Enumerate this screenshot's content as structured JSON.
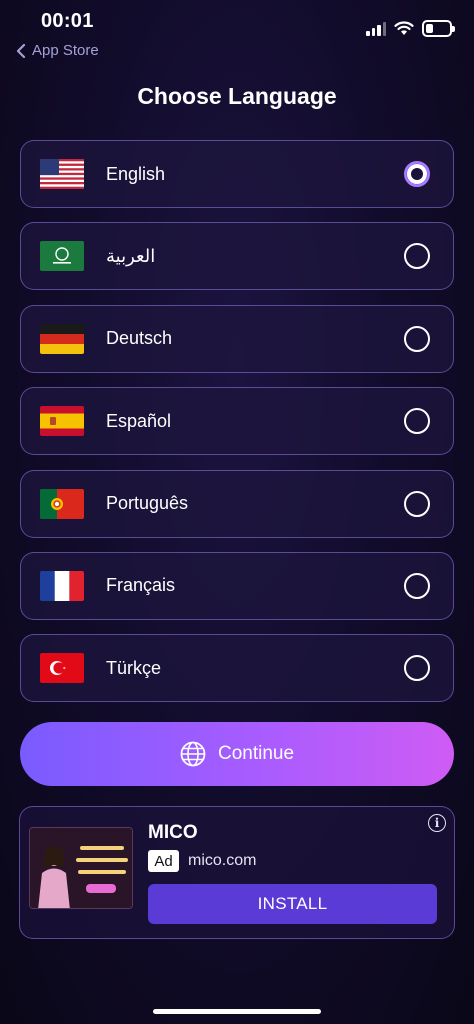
{
  "status_bar": {
    "time": "00:01",
    "back_label": "App Store",
    "battery_level": 0.3
  },
  "page_title": "Choose Language",
  "languages": [
    {
      "label": "English",
      "flag": "us-flag-icon",
      "selected": true
    },
    {
      "label": "العربية",
      "flag": "saudi-flag-icon",
      "selected": false
    },
    {
      "label": "Deutsch",
      "flag": "germany-flag-icon",
      "selected": false
    },
    {
      "label": "Español",
      "flag": "spain-flag-icon",
      "selected": false
    },
    {
      "label": "Português",
      "flag": "portugal-flag-icon",
      "selected": false
    },
    {
      "label": "Français",
      "flag": "france-flag-icon",
      "selected": false
    },
    {
      "label": "Türkçe",
      "flag": "turkey-flag-icon",
      "selected": false
    }
  ],
  "continue_button": {
    "label": "Continue",
    "icon": "globe-icon"
  },
  "ad": {
    "title": "MICO",
    "badge": "Ad",
    "domain": "mico.com",
    "install_label": "INSTALL",
    "info_symbol": "i"
  },
  "colors": {
    "accent": "#a77bff",
    "button_gradient_start": "#7a5bff",
    "button_gradient_end": "#cf5cf4",
    "install_button": "#5b3bd6",
    "background": "#120c2c"
  }
}
